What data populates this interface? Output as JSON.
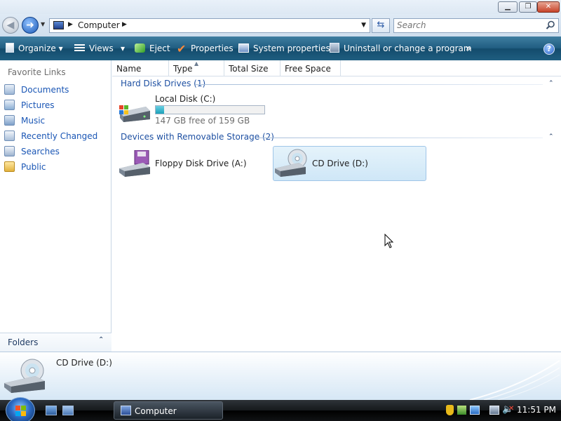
{
  "titlebar": {
    "min": "▁",
    "max": "❐",
    "close": "✕"
  },
  "address": {
    "location": "Computer",
    "drop": "▾",
    "back": "◀",
    "forward": "➜"
  },
  "search": {
    "placeholder": "Search"
  },
  "commands": {
    "organize": "Organize",
    "views": "Views",
    "eject": "Eject",
    "properties": "Properties",
    "system_properties": "System properties",
    "uninstall": "Uninstall or change a program",
    "more": "»",
    "help": "?",
    "dropdown_arrow": "▾"
  },
  "nav": {
    "favorites_title": "Favorite Links",
    "links": [
      "Documents",
      "Pictures",
      "Music",
      "Recently Changed",
      "Searches",
      "Public"
    ],
    "folders": "Folders",
    "folders_chevron": "⌃"
  },
  "columns": [
    "Name",
    "Type",
    "Total Size",
    "Free Space"
  ],
  "groups": {
    "hard": "Hard Disk Drives (1)",
    "removable": "Devices with Removable Storage (2)",
    "chevron": "⌃"
  },
  "drives": {
    "local": {
      "label": "Local Disk (C:)",
      "free_text": "147 GB free of 159 GB",
      "used_fraction": 0.075
    },
    "floppy": {
      "label": "Floppy Disk Drive (A:)"
    },
    "cd": {
      "label": "CD Drive (D:)"
    }
  },
  "details": {
    "title": "CD Drive (D:)"
  },
  "taskbar": {
    "task": "Computer",
    "clock": "11:51 PM"
  },
  "colors": {
    "link": "#1a56b5",
    "command_bar": "#1f5c80",
    "group": "#1e50a2",
    "selection": "#cfe7f7"
  }
}
